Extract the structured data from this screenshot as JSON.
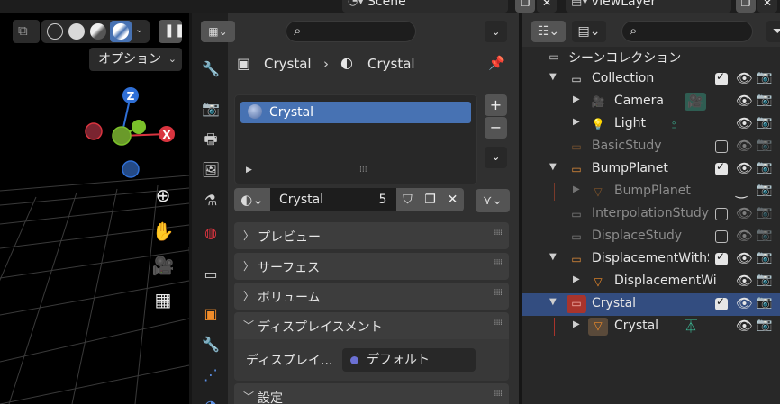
{
  "top_bar": {
    "scene_name": "Scene",
    "view_layer_name": "ViewLayer"
  },
  "viewport": {
    "options_label": "オプション",
    "gizmo": {
      "z_label": "Z",
      "x_label": "X"
    },
    "nav_tools": [
      "zoom-icon",
      "hand-pan-icon",
      "camera-view-icon",
      "grid-ortho-icon"
    ]
  },
  "properties": {
    "breadcrumb": {
      "object": "Crystal",
      "material": "Crystal"
    },
    "material_slots": [
      {
        "label": "Crystal",
        "selected": true
      }
    ],
    "material_field": {
      "name": "Crystal",
      "users": "5"
    },
    "panels": [
      {
        "label": "プレビュー",
        "expanded": false
      },
      {
        "label": "サーフェス",
        "expanded": false
      },
      {
        "label": "ボリューム",
        "expanded": false
      },
      {
        "label": "ディスプレイスメント",
        "expanded": true
      },
      {
        "label": "設定",
        "expanded": false
      }
    ],
    "displacement": {
      "label": "ディスプレイ...",
      "value": "デフォルト"
    },
    "tabs": [
      "tool-icon",
      "render-icon",
      "output-icon",
      "view-layer-icon",
      "scene-icon",
      "world-icon",
      "collection-icon",
      "object-icon",
      "modifier-icon",
      "particles-icon"
    ]
  },
  "outliner": {
    "rows": [
      {
        "name": "シーンコレクション",
        "type": "scene-collection"
      },
      {
        "name": "Collection",
        "type": "collection",
        "checked": true
      },
      {
        "name": "Camera",
        "type": "camera"
      },
      {
        "name": "Light",
        "type": "light"
      },
      {
        "name": "BasicStudy",
        "type": "collection",
        "checked": false,
        "dim": true
      },
      {
        "name": "BumpPlanet",
        "type": "collection",
        "checked": true
      },
      {
        "name": "BumpPlanet",
        "type": "mesh",
        "dim": true
      },
      {
        "name": "InterpolationStudy",
        "type": "collection",
        "checked": false,
        "dim": true
      },
      {
        "name": "DisplaceStudy",
        "type": "collection",
        "checked": false,
        "dim": true
      },
      {
        "name": "DisplacementWithSl",
        "type": "collection",
        "checked": true
      },
      {
        "name": "DisplacementWi",
        "type": "mesh"
      },
      {
        "name": "Crystal",
        "type": "collection",
        "checked": true,
        "selected": true
      },
      {
        "name": "Crystal",
        "type": "mesh"
      }
    ]
  },
  "colors": {
    "accent": "#4772b3",
    "selection_row": "#334d80",
    "gizmo_z": "#2f6fd6",
    "gizmo_x": "#d9343f",
    "gizmo_y": "#7ac02a",
    "camera_green": "#3ec6a0"
  }
}
